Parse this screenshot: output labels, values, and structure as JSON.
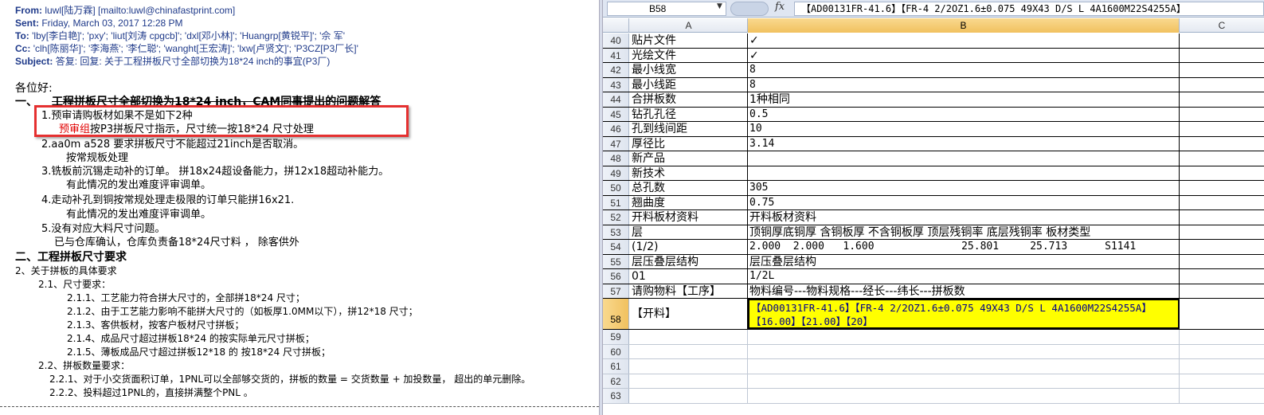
{
  "email": {
    "from_label": "From:",
    "from_value": "luwl[陆万霖] [mailto:luwl@chinafastprint.com]",
    "sent_label": "Sent:",
    "sent_value": "Friday, March 03, 2017 12:28 PM",
    "to_label": "To:",
    "to_value": "'lby[李白艳]'; 'pxy'; 'liut[刘涛 cpgcb]'; 'dxl[邓小林]'; 'Huangrp[黄锐平]'; '佘 军'",
    "cc_label": "Cc:",
    "cc_value": "'clh[陈丽华]'; '李海燕'; '李仁聪'; 'wanght[王宏涛]'; 'lxw[卢贤文]'; 'P3CZ[P3厂长]'",
    "subject_label": "Subject:",
    "subject_value": "答复: 回复: 关于工程拼板尺寸全部切换为18*24 inch的事宜(P3厂)",
    "greeting": "各位好:",
    "section1_prefix": "一、",
    "section1_title": "工程拼板尺寸全部切换为18*24 inch，CAM同事提出的问题解答",
    "item1": "1.预审请购板材如果不是如下2种",
    "item1_red": "预审组",
    "item1_rest": "按P3拼板尺寸指示，尺寸统一按18*24 尺寸处理",
    "item2": "2.aa0m a528 要求拼板尺寸不能超过21inch是否取消。",
    "item2_sub": "按常规板处理",
    "item3": "3.铣板前沉锡走动补的订单。 拼18x24超设备能力，拼12x18超动补能力。",
    "item3_sub": "有此情况的发出难度评审调单。",
    "item4": "4.走动补孔到铜按常规处理走极限的订单只能拼16x21.",
    "item4_sub": "有此情况的发出难度评审调单。",
    "item5": "5.没有对应大料尺寸问题。",
    "item5_sub": "已与仓库确认，仓库负责备18*24尺寸料 ， 除客供外",
    "section2_title": "二、工程拼板尺寸要求",
    "s2_1": "2、关于拼板的具体要求",
    "s2_1_1": "2.1、尺寸要求：",
    "s2_1_1_1": "2.1.1、工艺能力符合拼大尺寸的，全部拼18*24 尺寸；",
    "s2_1_1_2": "2.1.2、由于工艺能力影响不能拼大尺寸的（如板厚1.0MM以下），拼12*18 尺寸；",
    "s2_1_1_3": "2.1.3、客供板材，按客户板材尺寸拼板；",
    "s2_1_1_4": "2.1.4、成品尺寸超过拼板18*24 的按实际单元尺寸拼板；",
    "s2_1_1_5": "2.1.5、薄板成品尺寸超过拼板12*18 的 按18*24 尺寸拼板；",
    "s2_2": "2.2、拼板数量要求：",
    "s2_2_1": "2.2.1、对于小交货面积订单，1PNL可以全部够交货的，拼板的数量 = 交货数量 + 加投数量， 超出的单元删除。",
    "s2_2_2": "2.2.2、投料超过1PNL的，直接拼满整个PNL 。"
  },
  "excel": {
    "namebox": "B58",
    "fx": "fx",
    "formula": "【AD00131FR-41.6】【FR-4 2/2OZ1.6±0.075 49X43  D/S L 4A1600M22S4255A】",
    "columns": [
      "A",
      "B",
      "C"
    ],
    "rows": [
      {
        "num": "40",
        "a": "贴片文件",
        "b": "✓"
      },
      {
        "num": "41",
        "a": "光绘文件",
        "b": "✓"
      },
      {
        "num": "42",
        "a": "最小线宽",
        "b": "8"
      },
      {
        "num": "43",
        "a": "最小线距",
        "b": "8"
      },
      {
        "num": "44",
        "a": "合拼板数",
        "b": "1种相同"
      },
      {
        "num": "45",
        "a": "钻孔孔径",
        "b": "0.5"
      },
      {
        "num": "46",
        "a": "孔到线间距",
        "b": "10"
      },
      {
        "num": "47",
        "a": "厚径比",
        "b": "3.14"
      },
      {
        "num": "48",
        "a": "新产品",
        "b": ""
      },
      {
        "num": "49",
        "a": "新技术",
        "b": ""
      },
      {
        "num": "50",
        "a": "总孔数",
        "b": "305"
      },
      {
        "num": "51",
        "a": "翘曲度",
        "b": "0.75"
      },
      {
        "num": "52",
        "a": "开料板材资料",
        "b": "开料板材资料"
      },
      {
        "num": "53",
        "a": "层",
        "b": "顶铜厚底铜厚 含铜板厚 不含铜板厚 顶层残铜率 底层残铜率 板材类型"
      },
      {
        "num": "54",
        "a": "(1/2)",
        "b": "2.000  2.000   1.600              25.801     25.713      S1141"
      },
      {
        "num": "55",
        "a": "层压叠层结构",
        "b": "层压叠层结构"
      },
      {
        "num": "56",
        "a": "01",
        "b": "1/2L"
      },
      {
        "num": "57",
        "a": "请购物料【工序】",
        "b": "物料编号---物料规格---经长---纬长---拼板数"
      },
      {
        "num": "58",
        "a": "【开料】",
        "b": "【AD00131FR-41.6】【FR-4 2/2OZ1.6±0.075 49X43  D/S L 4A1600M22S4255A】【16.00】【21.00】【20】"
      },
      {
        "num": "59",
        "a": "",
        "b": ""
      },
      {
        "num": "60",
        "a": "",
        "b": ""
      },
      {
        "num": "61",
        "a": "",
        "b": ""
      },
      {
        "num": "62",
        "a": "",
        "b": ""
      },
      {
        "num": "63",
        "a": "",
        "b": ""
      }
    ]
  }
}
